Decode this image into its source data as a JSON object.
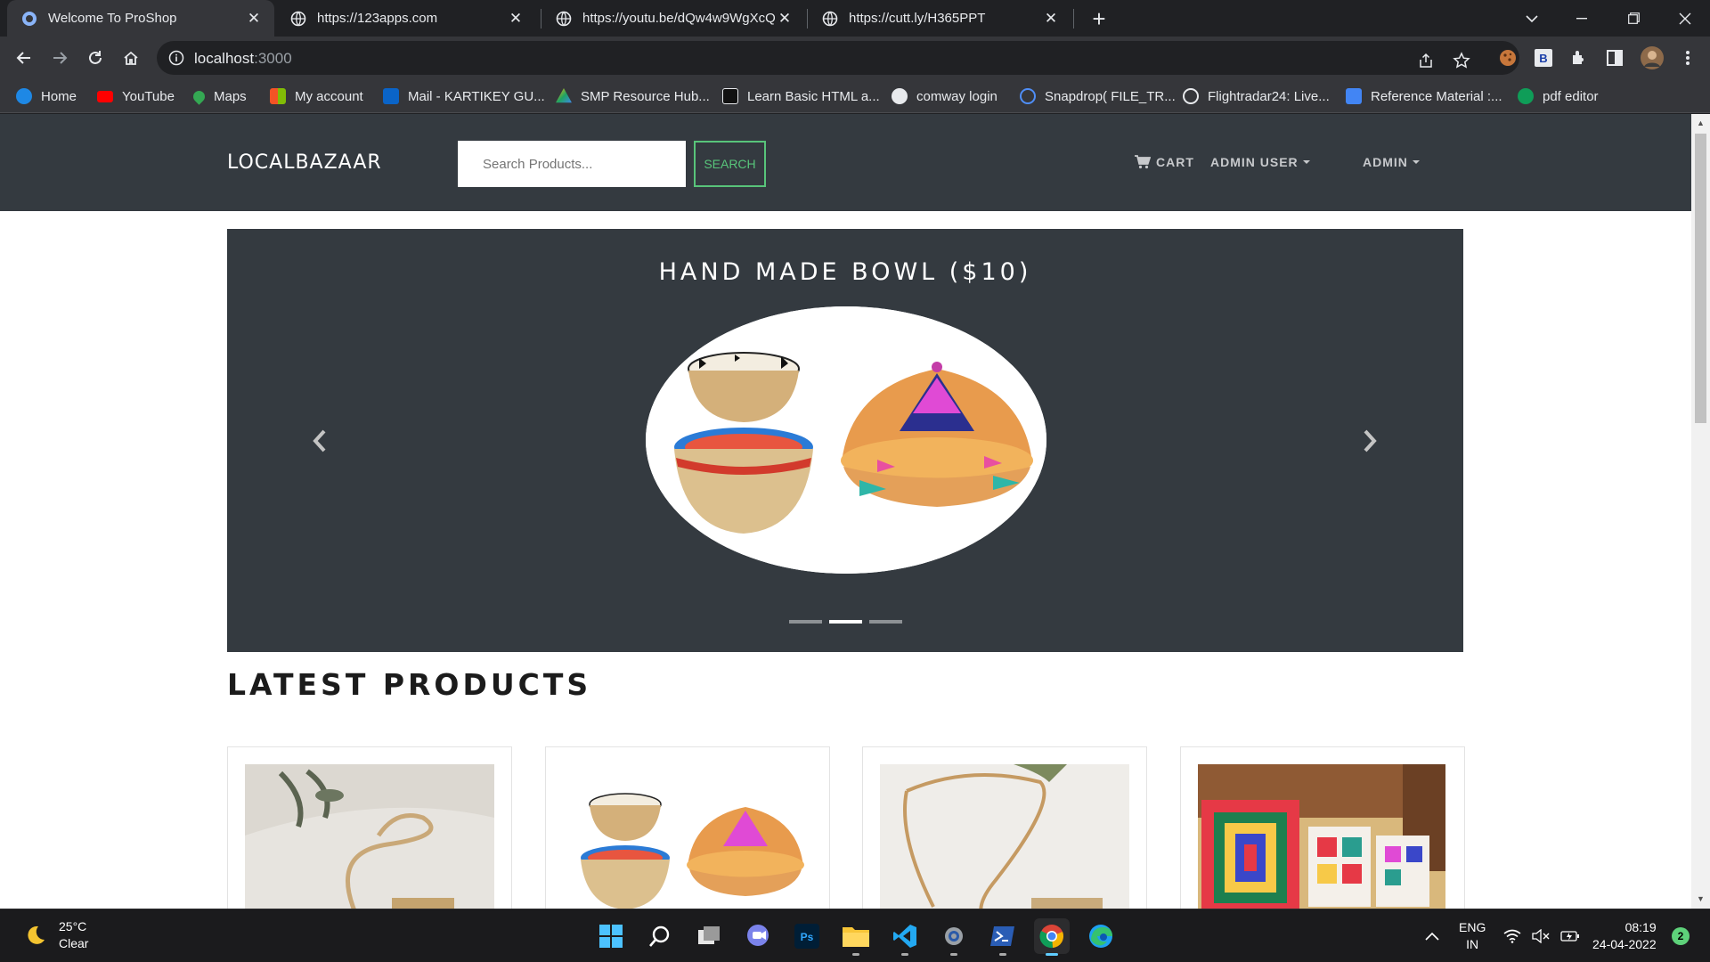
{
  "browser": {
    "tabs": [
      {
        "title": "Welcome To ProShop",
        "active": true
      },
      {
        "title": "https://123apps.com",
        "active": false
      },
      {
        "title": "https://youtu.be/dQw4w9WgXcQ",
        "active": false
      },
      {
        "title": "https://cutt.ly/H365PPT",
        "active": false
      }
    ],
    "url_host": "localhost",
    "url_port": ":3000",
    "bookmarks": [
      {
        "label": "Home",
        "color": "#1e88e5"
      },
      {
        "label": "YouTube",
        "color": "#ff0000"
      },
      {
        "label": "Maps",
        "color": "#34a853"
      },
      {
        "label": "My account",
        "color": "#fbbc05"
      },
      {
        "label": "Mail - KARTIKEY GU...",
        "color": "#0a64c8"
      },
      {
        "label": "SMP Resource Hub...",
        "color": "#1fa463"
      },
      {
        "label": "Learn Basic HTML a...",
        "color": "#111111"
      },
      {
        "label": "comway login",
        "color": "#e8eaed"
      },
      {
        "label": "Snapdrop( FILE_TR...",
        "color": "#4f8ef7"
      },
      {
        "label": "Flightradar24: Live...",
        "color": "#e8eaed"
      },
      {
        "label": "Reference Material :...",
        "color": "#4285f4"
      },
      {
        "label": "pdf editor",
        "color": "#0f9d58"
      }
    ]
  },
  "site": {
    "brand": "LOCALBAZAAR",
    "search": {
      "placeholder": "Search Products...",
      "button": "SEARCH"
    },
    "nav": {
      "cart": "CART",
      "user": "ADMIN USER",
      "admin": "ADMIN"
    },
    "carousel": {
      "caption": "HAND MADE BOWL ($10)",
      "slide_count": 3,
      "active_slide": 2
    },
    "latest_title": "LATEST PRODUCTS",
    "products": [
      {
        "image": "woven-sling-bag"
      },
      {
        "image": "hand-made-bowls"
      },
      {
        "image": "rope-crossbody-bag"
      },
      {
        "image": "crochet-cushions"
      }
    ]
  },
  "taskbar": {
    "weather_temp": "25°C",
    "weather_desc": "Clear",
    "lang_top": "ENG",
    "lang_bottom": "IN",
    "time": "08:19",
    "date": "24-04-2022",
    "notifications": "2"
  },
  "colors": {
    "navbar": "#343a40",
    "accent_green": "#58c47a"
  }
}
